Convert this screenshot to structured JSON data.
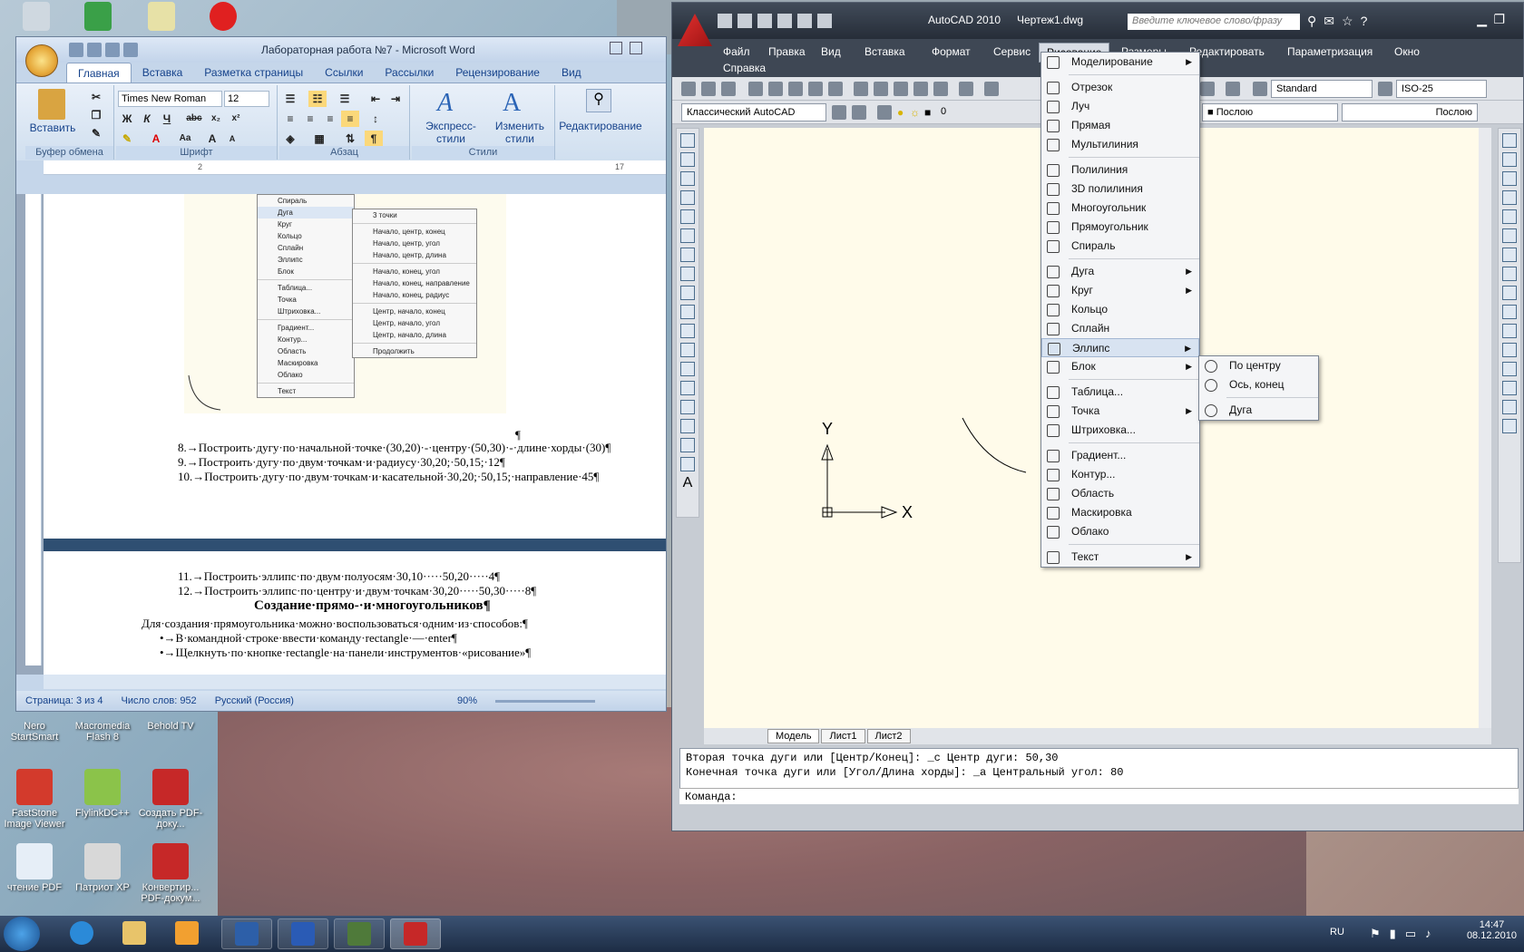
{
  "desktop": {
    "icons": [
      {
        "label": "Nero StartSmart"
      },
      {
        "label": "Macromedia Flash 8"
      },
      {
        "label": "Behold TV"
      },
      {
        "label": "FastStone Image Viewer"
      },
      {
        "label": "FlylinkDC++"
      },
      {
        "label": "Создать PDF-доку..."
      },
      {
        "label": "чтение PDF"
      },
      {
        "label": "Патриот XP"
      },
      {
        "label": "Конвертир... PDF-докум..."
      }
    ]
  },
  "word": {
    "title": "Лабораторная работа №7 - Microsoft Word",
    "tabs": [
      "Главная",
      "Вставка",
      "Разметка страницы",
      "Ссылки",
      "Рассылки",
      "Рецензирование",
      "Вид"
    ],
    "font_name": "Times New Roman",
    "font_size": "12",
    "groups": {
      "clipboard": "Буфер обмена",
      "font": "Шрифт",
      "paragraph": "Абзац",
      "styles": "Стили"
    },
    "paste_label": "Вставить",
    "express_styles": "Экспресс-стили",
    "change_styles": "Изменить стили",
    "editing": "Редактирование",
    "menu_main": [
      "Спираль",
      "Дуга",
      "Круг",
      "Кольцо",
      "Сплайн",
      "Эллипс",
      "Блок",
      "Таблица...",
      "Точка",
      "Штриховка...",
      "Градиент...",
      "Контур...",
      "Область",
      "Маскировка",
      "Облако",
      "Текст"
    ],
    "menu_arc": [
      "3 точки",
      "Начало, центр, конец",
      "Начало, центр, угол",
      "Начало, центр, длина",
      "Начало, конец, угол",
      "Начало, конец, направление",
      "Начало, конец, радиус",
      "Центр, начало, конец",
      "Центр, начало, угол",
      "Центр, начало, длина",
      "Продолжить"
    ],
    "lines_top": [
      "8.→Построить·дугу·по·начальной·точке·(30,20)·-·центру·(50,30)·-·длине·хорды·(30)¶",
      "9.→Построить·дугу·по·двум·точкам·и·радиусу·30,20;·50,15;·12¶",
      "10.→Построить·дугу·по·двум·точкам·и·касательной·30,20;·50,15;·направление·45¶"
    ],
    "lines_bottom": [
      "11.→Построить·эллипс·по·двум·полуосям·30,10·····50,20·····4¶",
      "12.→Построить·эллипс·по·центру·и·двум·точкам·30,20·····50,30·····8¶"
    ],
    "heading": "Создание·прямо-·и·многоугольников¶",
    "para": "Для·создания·прямоугольника·можно·воспользоваться·одним·из·способов:¶",
    "bullets": [
      "•→В·командной·строке·ввести·команду·rectangle·—·enter¶",
      "•→Щелкнуть·по·кнопке·rectangle·на·панели·инструментов·«рисование»¶"
    ],
    "pilcrow": "¶",
    "status": {
      "page": "Страница: 3 из 4",
      "words": "Число слов: 952",
      "lang": "Русский (Россия)",
      "zoom": "90%"
    }
  },
  "autocad": {
    "app_name": "AutoCAD 2010",
    "file_name": "Чертеж1.dwg",
    "search_placeholder": "Введите ключевое слово/фразу",
    "menus": [
      "Файл",
      "Правка",
      "Вид",
      "Вставка",
      "Формат",
      "Сервис",
      "Рисование",
      "Размеры",
      "Редактировать",
      "Параметризация",
      "Окно",
      "Справка"
    ],
    "workspace": "Классический AutoCAD",
    "text_style": "Standard",
    "dim_style": "ISO-25",
    "layer": "0",
    "color": "Послою",
    "linetype": "Послою",
    "draw_menu": [
      {
        "label": "Моделирование",
        "arrow": true
      },
      {
        "sep": true
      },
      {
        "label": "Отрезок"
      },
      {
        "label": "Луч"
      },
      {
        "label": "Прямая"
      },
      {
        "label": "Мультилиния"
      },
      {
        "sep": true
      },
      {
        "label": "Полилиния"
      },
      {
        "label": "3D полилиния"
      },
      {
        "label": "Многоугольник"
      },
      {
        "label": "Прямоугольник"
      },
      {
        "label": "Спираль"
      },
      {
        "sep": true
      },
      {
        "label": "Дуга",
        "arrow": true
      },
      {
        "label": "Круг",
        "arrow": true
      },
      {
        "label": "Кольцо"
      },
      {
        "label": "Сплайн"
      },
      {
        "label": "Эллипс",
        "arrow": true,
        "hl": true
      },
      {
        "label": "Блок",
        "arrow": true
      },
      {
        "sep": true
      },
      {
        "label": "Таблица..."
      },
      {
        "label": "Точка",
        "arrow": true
      },
      {
        "label": "Штриховка..."
      },
      {
        "sep": true
      },
      {
        "label": "Градиент..."
      },
      {
        "label": "Контур..."
      },
      {
        "label": "Область"
      },
      {
        "label": "Маскировка"
      },
      {
        "label": "Облако"
      },
      {
        "sep": true
      },
      {
        "label": "Текст",
        "arrow": true
      }
    ],
    "ellipse_menu": [
      "По центру",
      "Ось, конец",
      "Дуга"
    ],
    "axis_y": "Y",
    "axis_x": "X",
    "sheet_tabs": [
      "Модель",
      "Лист1",
      "Лист2"
    ],
    "cmd_lines": [
      "Вторая точка дуги или [Центр/Конец]: _c Центр дуги: 50,30",
      "Конечная точка дуги или [Угол/Длина хорды]: _a Центральный угол: 80"
    ],
    "cmd_prompt": "Команда:"
  },
  "taskbar": {
    "lang": "RU",
    "time": "14:47",
    "date": "08.12.2010"
  }
}
